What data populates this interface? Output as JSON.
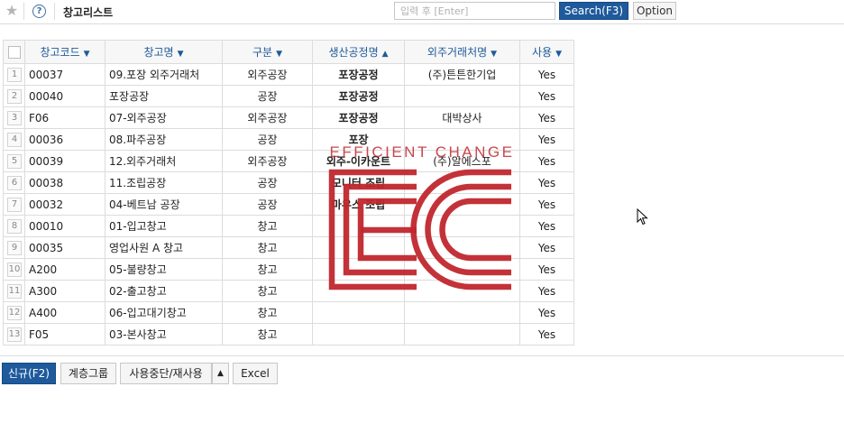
{
  "header": {
    "favorite_icon": "star-icon",
    "help_icon": "help-circle-icon",
    "help_glyph": "?",
    "title": "창고리스트",
    "search_placeholder": "입력 후 [Enter]",
    "search_value": "",
    "search_button": "Search(F3)",
    "option_button": "Option"
  },
  "grid": {
    "columns": [
      {
        "label": "창고코드",
        "sort": "down"
      },
      {
        "label": "창고명",
        "sort": "down"
      },
      {
        "label": "구분",
        "sort": "down"
      },
      {
        "label": "생산공정명",
        "sort": "up"
      },
      {
        "label": "외주거래처명",
        "sort": "down"
      },
      {
        "label": "사용",
        "sort": "down"
      }
    ],
    "rows": [
      {
        "num": "1",
        "code": "00037",
        "name": "09.포장 외주거래처",
        "type": "외주공장",
        "process": "포장공정",
        "vendor": "(주)튼튼한기업",
        "use": "Yes"
      },
      {
        "num": "2",
        "code": "00040",
        "name": "포장공장",
        "type": "공장",
        "process": "포장공정",
        "vendor": "",
        "use": "Yes"
      },
      {
        "num": "3",
        "code": "F06",
        "name": "07-외주공장",
        "type": "외주공장",
        "process": "포장공정",
        "vendor": "대박상사",
        "use": "Yes"
      },
      {
        "num": "4",
        "code": "00036",
        "name": "08.파주공장",
        "type": "공장",
        "process": "포장",
        "vendor": "",
        "use": "Yes"
      },
      {
        "num": "5",
        "code": "00039",
        "name": "12.외주거래처",
        "type": "외주공장",
        "process": "외주-이카운트",
        "vendor": "(주)알에스포",
        "use": "Yes"
      },
      {
        "num": "6",
        "code": "00038",
        "name": "11.조립공장",
        "type": "공장",
        "process": "모니터 조립",
        "vendor": "",
        "use": "Yes"
      },
      {
        "num": "7",
        "code": "00032",
        "name": "04-베트남 공장",
        "type": "공장",
        "process": "마우스 조립",
        "vendor": "",
        "use": "Yes"
      },
      {
        "num": "8",
        "code": "00010",
        "name": "01-입고창고",
        "type": "창고",
        "process": "",
        "vendor": "",
        "use": "Yes"
      },
      {
        "num": "9",
        "code": "00035",
        "name": "영업사원 A 창고",
        "type": "창고",
        "process": "",
        "vendor": "",
        "use": "Yes"
      },
      {
        "num": "10",
        "code": "A200",
        "name": "05-불량창고",
        "type": "창고",
        "process": "",
        "vendor": "",
        "use": "Yes"
      },
      {
        "num": "11",
        "code": "A300",
        "name": "02-출고창고",
        "type": "창고",
        "process": "",
        "vendor": "",
        "use": "Yes"
      },
      {
        "num": "12",
        "code": "A400",
        "name": "06-입고대기창고",
        "type": "창고",
        "process": "",
        "vendor": "",
        "use": "Yes"
      },
      {
        "num": "13",
        "code": "F05",
        "name": "03-본사창고",
        "type": "창고",
        "process": "",
        "vendor": "",
        "use": "Yes"
      }
    ]
  },
  "footer": {
    "new_button": "신규(F2)",
    "hierarchy_button": "계층그룹",
    "suspend_button": "사용중단/재사용",
    "excel_button": "Excel"
  },
  "watermark": {
    "text": "EFFICIENT CHANGE",
    "color": "#c0272d"
  },
  "colors": {
    "accent": "#1e5a9c",
    "link": "#1f5a9b"
  }
}
